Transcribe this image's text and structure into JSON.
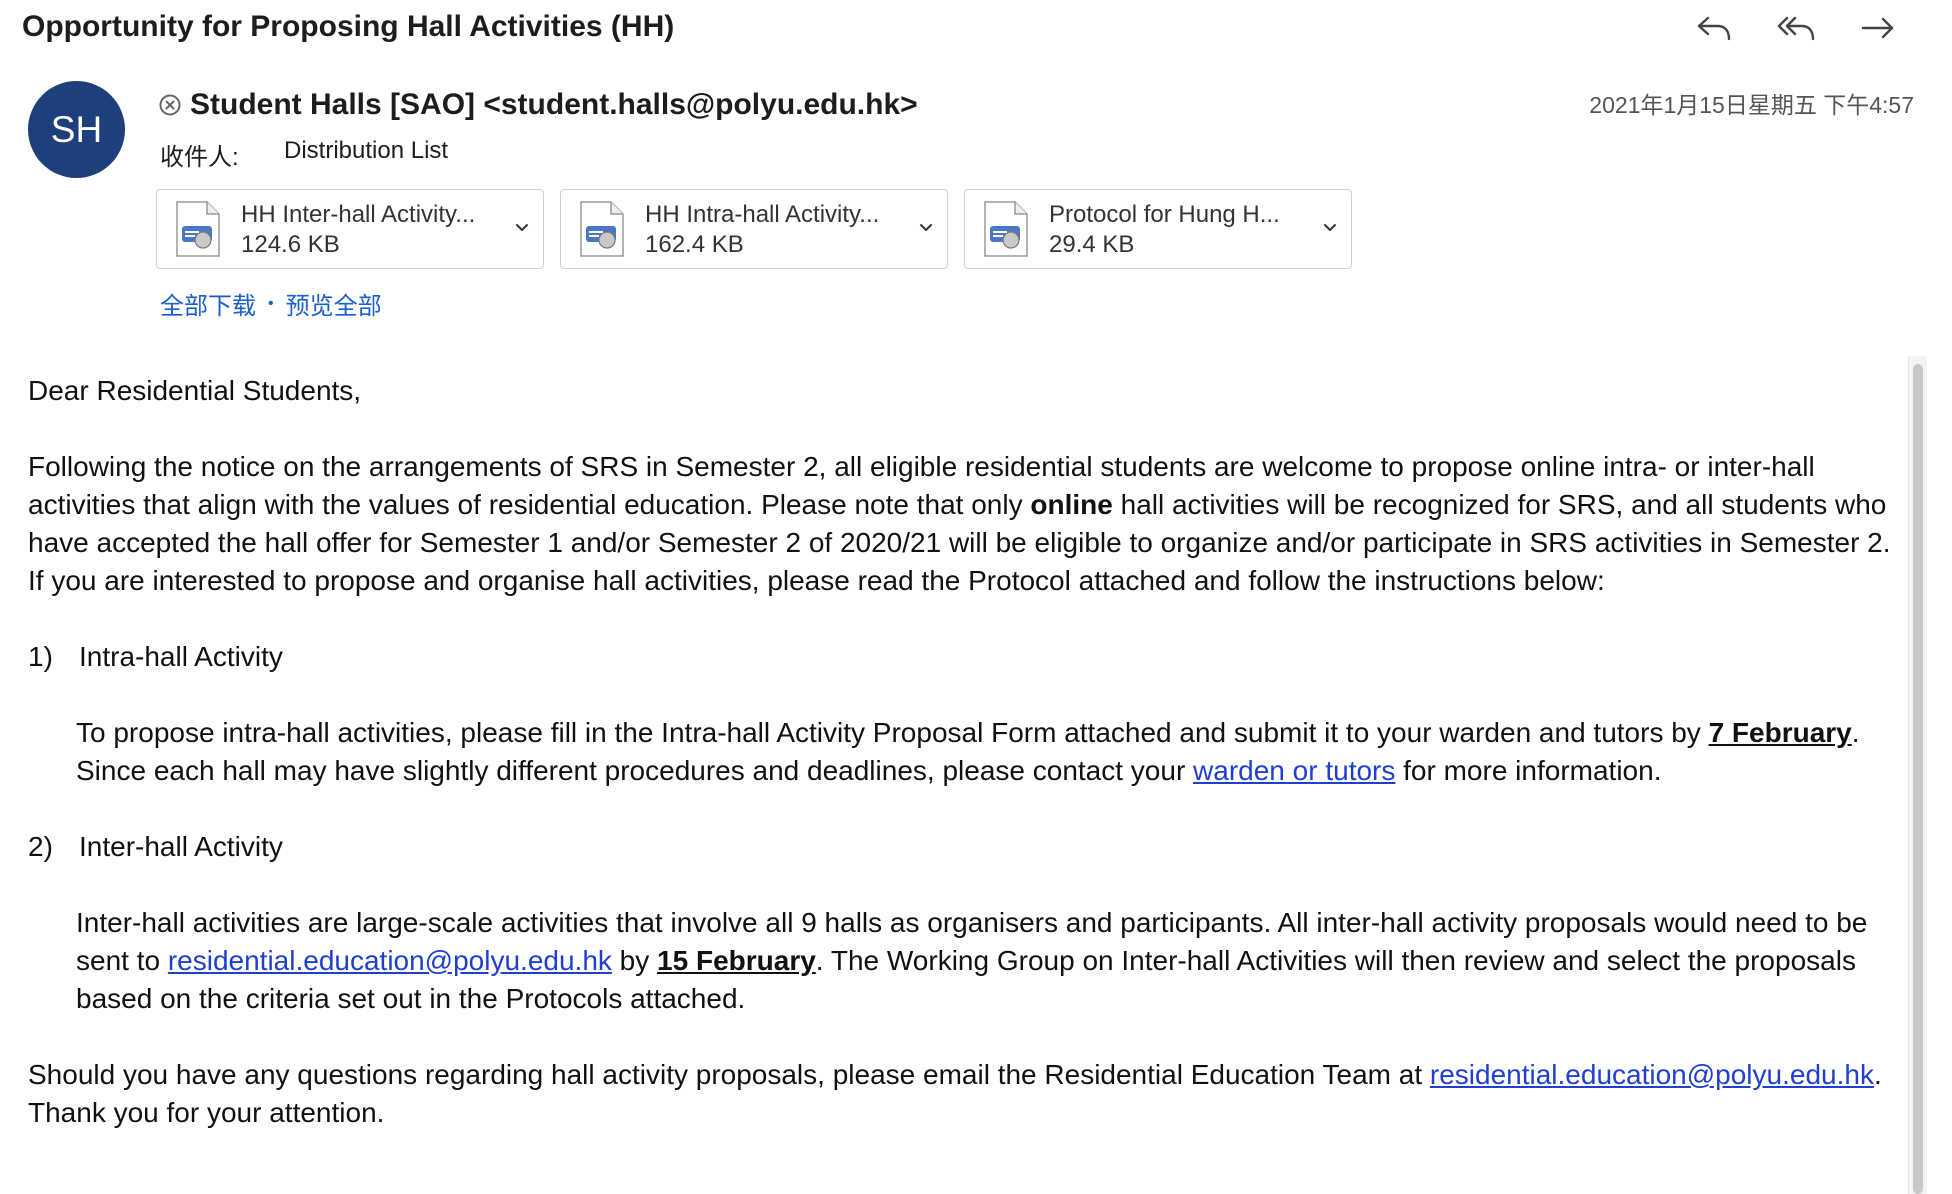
{
  "email": {
    "subject": "Opportunity for Proposing Hall Activities (HH)",
    "avatar_initials": "SH",
    "avatar_color": "#1d3f7c",
    "sender": "Student Halls [SAO] <student.halls@polyu.edu.hk>",
    "datetime": "2021年1月15日星期五 下午4:57",
    "to_label": "收件人:",
    "to_value": "Distribution List"
  },
  "actions": {
    "reply_icon": "reply-icon",
    "reply_all_icon": "reply-all-icon",
    "forward_icon": "forward-icon"
  },
  "attachments": [
    {
      "name": "HH Inter-hall Activity...",
      "size": "124.6 KB"
    },
    {
      "name": "HH Intra-hall Activity...",
      "size": "162.4 KB"
    },
    {
      "name": "Protocol for Hung H...",
      "size": "29.4 KB"
    }
  ],
  "attachment_links": {
    "download_all": "全部下载",
    "separator": "•",
    "preview_all": "预览全部"
  },
  "body": {
    "greeting": "Dear Residential Students,",
    "intro_a": "Following the notice on the arrangements of SRS in Semester 2, all eligible residential students are welcome to propose online intra- or inter-hall activities that align with the values of residential education.  Please note that only ",
    "intro_bold": "online",
    "intro_b": " hall activities will be recognized for SRS, and all students who have accepted the hall offer for Semester 1 and/or Semester 2 of 2020/21 will be eligible to organize and/or participate in SRS activities in Semester 2.  If you are interested to propose and organise hall activities, please read the Protocol attached and follow the instructions below:",
    "item1_num": "1)",
    "item1_title": "Intra-hall Activity",
    "item1_a": "To propose intra-hall activities, please fill in the Intra-hall Activity Proposal Form attached and submit it to your warden and tutors by ",
    "item1_deadline": "7 February",
    "item1_b": ".  Since each hall may have slightly different procedures and deadlines, please contact your ",
    "item1_link": "warden or tutors",
    "item1_c": " for more information.",
    "item2_num": "2)",
    "item2_title": "Inter-hall Activity",
    "item2_a": "Inter-hall activities are large-scale activities that involve all 9 halls as organisers and participants. All inter-hall activity proposals would need to be sent to ",
    "item2_link": "residential.education@polyu.edu.hk",
    "item2_b": " by ",
    "item2_deadline": "15 February",
    "item2_c": ".  The Working Group on Inter-hall Activities will then review and select the proposals based on the criteria set out in the Protocols attached.",
    "closing_a": "Should you have any questions regarding hall activity proposals, please email the Residential Education Team at ",
    "closing_link": "residential.education@polyu.edu.hk",
    "closing_b": ".  Thank you for your attention."
  }
}
